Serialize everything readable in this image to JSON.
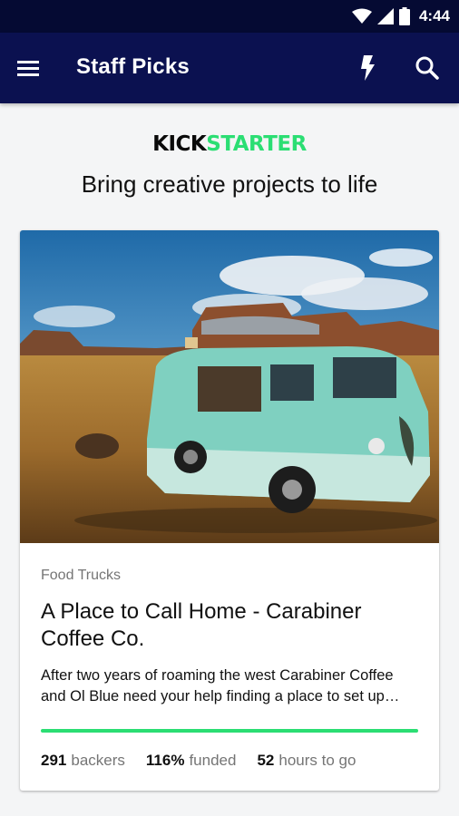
{
  "status_bar": {
    "time": "4:44",
    "icons": [
      "wifi-icon",
      "cellular-signal-icon",
      "battery-icon"
    ]
  },
  "app_bar": {
    "title": "Staff Picks",
    "icons": [
      "menu-icon",
      "lightning-icon",
      "search-icon"
    ]
  },
  "brand": {
    "logo_kick": "KICK",
    "logo_starter": "STARTER",
    "tagline": "Bring creative projects to life"
  },
  "project": {
    "category": "Food Trucks",
    "title": "A Place to Call Home - Carabiner Coffee Co.",
    "blurb": "After two years of roaming the west Carabiner Coffee and Ol Blue need your help finding a place to set up…",
    "funded_fraction": 1.0,
    "stats": {
      "backers_value": "291",
      "backers_label": "backers",
      "funded_value": "116%",
      "funded_label": "funded",
      "time_value": "52",
      "time_label": "hours to go"
    }
  },
  "colors": {
    "status_bar": "#050a33",
    "app_bar": "#0b1150",
    "brand_green": "#2bde73",
    "background": "#f4f5f6"
  }
}
